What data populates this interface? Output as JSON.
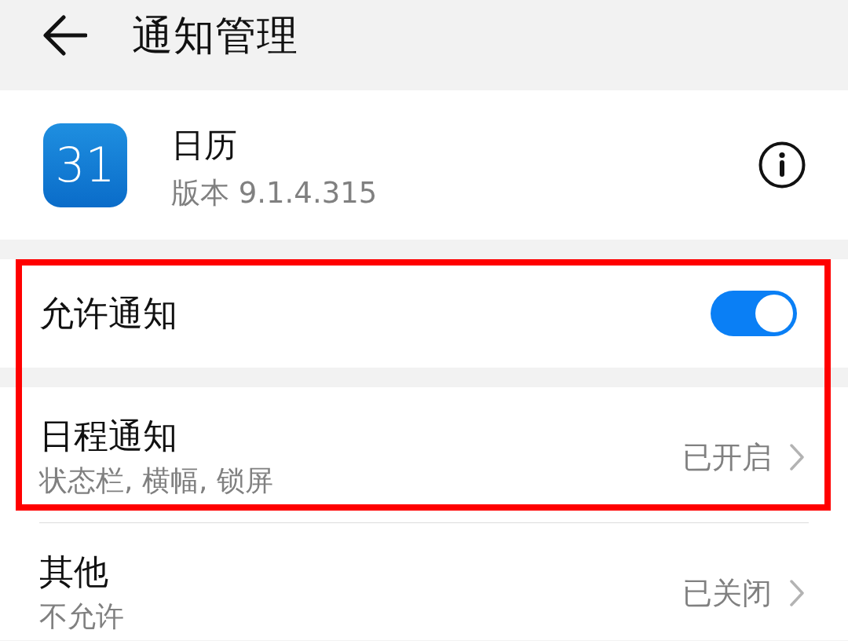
{
  "header": {
    "title": "通知管理"
  },
  "app": {
    "icon_text": "31",
    "name": "日历",
    "version": "版本 9.1.4.315"
  },
  "settings": [
    {
      "kind": "toggle",
      "label": "允许通知",
      "on": true,
      "highlighted": true
    },
    {
      "kind": "link",
      "label": "日程通知",
      "detail": "状态栏, 横幅, 锁屏",
      "value": "已开启",
      "highlighted": true
    },
    {
      "kind": "link",
      "label": "其他",
      "detail": "不允许",
      "value": "已关闭",
      "highlighted": false
    }
  ]
}
